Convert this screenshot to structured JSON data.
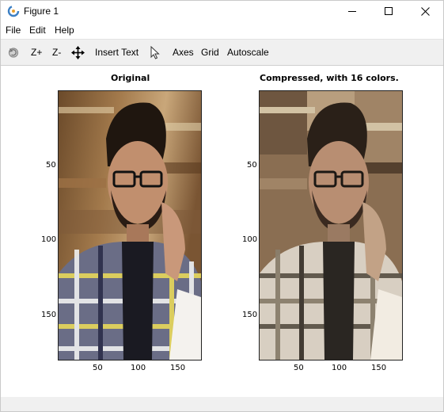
{
  "window": {
    "title": "Figure 1"
  },
  "menubar": {
    "items": [
      "File",
      "Edit",
      "Help"
    ]
  },
  "toolbar": {
    "zoom_in": "Z+",
    "zoom_out": "Z-",
    "insert_text": "Insert Text",
    "axes": "Axes",
    "grid": "Grid",
    "autoscale": "Autoscale"
  },
  "plots": [
    {
      "title": "Original",
      "xticks": [
        "50",
        "100",
        "150"
      ],
      "yticks": [
        "50",
        "100",
        "150"
      ],
      "tone": "original"
    },
    {
      "title": "Compressed, with 16 colors.",
      "xticks": [
        "50",
        "100",
        "150"
      ],
      "yticks": [
        "50",
        "100",
        "150"
      ],
      "tone": "compressed"
    }
  ]
}
